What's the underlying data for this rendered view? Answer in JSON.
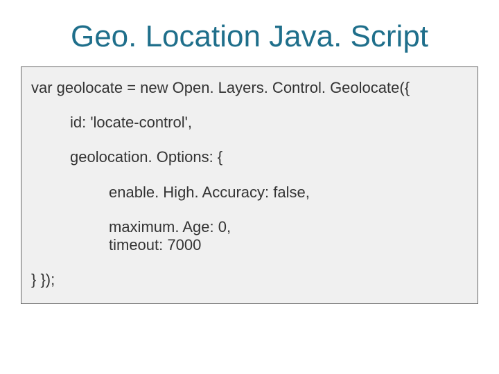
{
  "title": "Geo. Location Java. Script",
  "code": {
    "l1": "var geolocate = new Open. Layers. Control. Geolocate({",
    "l2": "id: 'locate-control',",
    "l3": "geolocation. Options: {",
    "l4": "enable. High. Accuracy: false,",
    "l5": "maximum. Age: 0,",
    "l6": "timeout: 7000",
    "l7": "} });"
  }
}
